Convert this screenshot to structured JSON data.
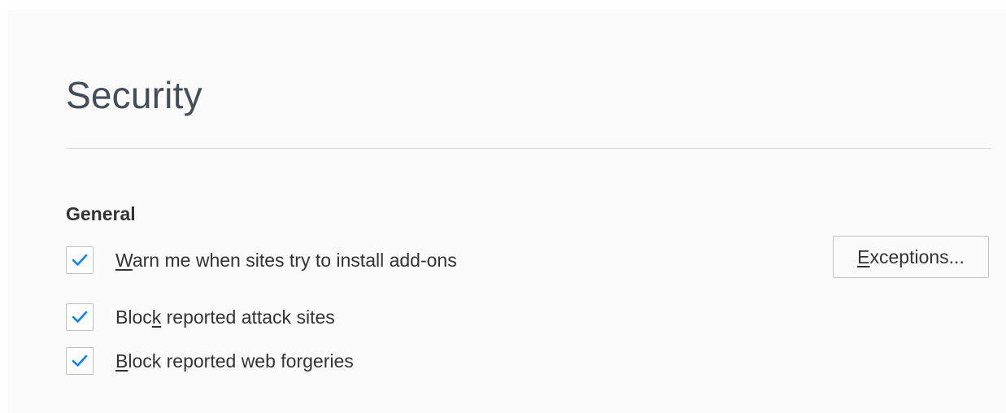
{
  "section": {
    "title": "Security"
  },
  "general": {
    "heading": "General",
    "options": [
      {
        "label_accesskey": "W",
        "label_rest": "arn me when sites try to install add-ons",
        "checked": true
      },
      {
        "label_before": "Bloc",
        "label_accesskey": "k",
        "label_rest": " reported attack sites",
        "checked": true
      },
      {
        "label_accesskey": "B",
        "label_rest": "lock reported web forgeries",
        "checked": true
      }
    ],
    "exceptions_button": {
      "accesskey": "E",
      "rest": "xceptions..."
    }
  },
  "colors": {
    "check": "#0a84ff",
    "title": "#424e5a",
    "text": "#333333",
    "background": "#fbfbfb"
  },
  "icons": {
    "checkmark": "checkmark-icon"
  }
}
